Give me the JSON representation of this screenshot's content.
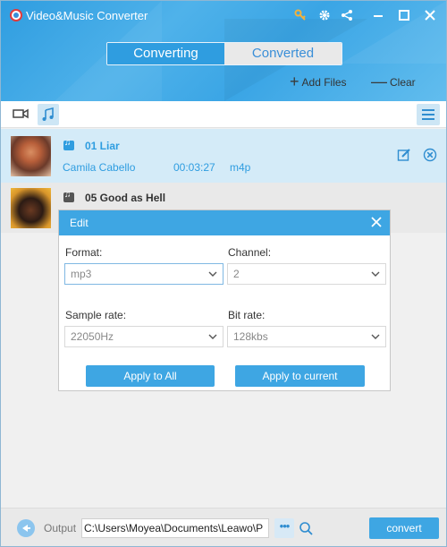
{
  "app": {
    "title": "Video&Music Converter"
  },
  "header": {
    "tabs": [
      {
        "label": "Converting",
        "active": true
      },
      {
        "label": "Converted",
        "active": false
      }
    ],
    "add_files_label": "Add Files",
    "clear_label": "Clear",
    "window_icons": [
      "key-icon",
      "gear-icon",
      "share-icon",
      "minimize-icon",
      "maximize-icon",
      "close-icon"
    ]
  },
  "toolbar": {
    "icons": [
      "video-camera-icon",
      "music-note-icon",
      "menu-icon"
    ],
    "active": "music-note-icon"
  },
  "tracks": [
    {
      "title": "01 Liar",
      "artist": "Camila Cabello",
      "duration": "00:03:27",
      "format": "m4p",
      "selected": true
    },
    {
      "title": "05 Good as Hell",
      "selected": false
    }
  ],
  "edit_dialog": {
    "title": "Edit",
    "format_label": "Format:",
    "format_value": "mp3",
    "channel_label": "Channel:",
    "channel_value": "2",
    "sample_rate_label": "Sample rate:",
    "sample_rate_value": "22050Hz",
    "bit_rate_label": "Bit rate:",
    "bit_rate_value": "128kbs",
    "apply_all_label": "Apply to All",
    "apply_current_label": "Apply to current"
  },
  "footer": {
    "output_label": "Output",
    "output_path": "C:\\Users\\Moyea\\Documents\\Leawo\\P",
    "more_label": "•••",
    "convert_label": "convert"
  },
  "colors": {
    "accent": "#3ea6e3",
    "header_blue": "#2f9de0",
    "selected_row": "#d4ebf8"
  }
}
